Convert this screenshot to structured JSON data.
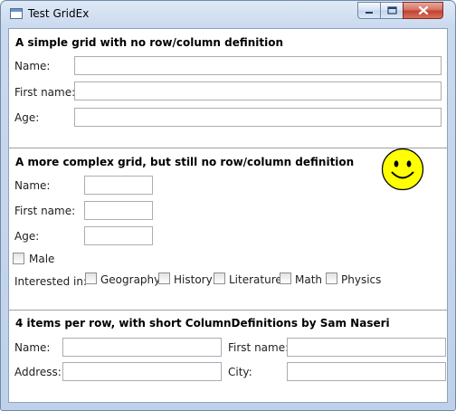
{
  "window": {
    "title": "Test GridEx",
    "icon": "window-app-icon",
    "controls": {
      "minimize": "minimize-icon",
      "maximize": "maximize-icon",
      "close": "close-icon"
    }
  },
  "section1": {
    "title": "A simple grid with no row/column definition",
    "name_label": "Name:",
    "name_value": "",
    "firstname_label": "First name:",
    "firstname_value": "",
    "age_label": "Age:",
    "age_value": ""
  },
  "section2": {
    "title": "A more complex grid, but still no row/column definition",
    "name_label": "Name:",
    "name_value": "",
    "firstname_label": "First name:",
    "firstname_value": "",
    "age_label": "Age:",
    "age_value": "",
    "male_label": "Male",
    "male_checked": false,
    "interested_label": "Interested in:",
    "interests": [
      {
        "label": "Geography",
        "checked": false
      },
      {
        "label": "History",
        "checked": false
      },
      {
        "label": "Literature",
        "checked": false
      },
      {
        "label": "Math",
        "checked": false
      },
      {
        "label": "Physics",
        "checked": false
      }
    ],
    "smiley": "smiley-face-icon",
    "smiley_color": "#ffff00"
  },
  "section3": {
    "title": "4 items per row, with short ColumnDefinitions by Sam Naseri",
    "name_label": "Name:",
    "name_value": "",
    "firstname_label": "First name:",
    "firstname_value": "",
    "address_label": "Address:",
    "address_value": "",
    "city_label": "City:",
    "city_value": ""
  }
}
